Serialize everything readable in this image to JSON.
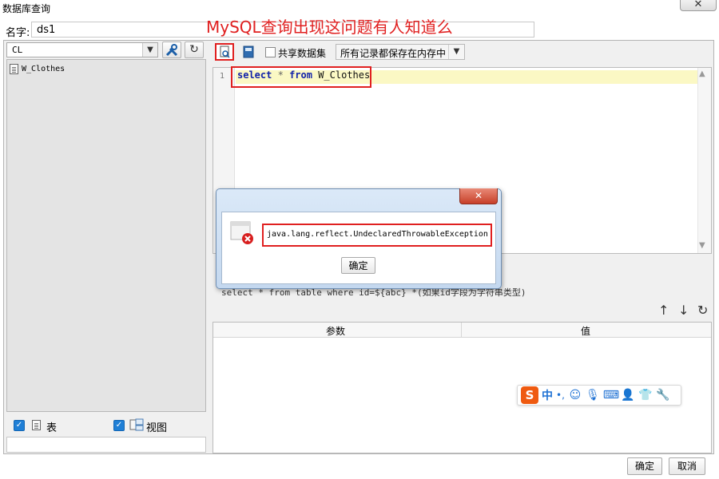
{
  "window": {
    "title": "数据库查询",
    "close_glyph": "✕"
  },
  "name_field": {
    "label": "名字:",
    "value": "ds1"
  },
  "annotation": "MySQL查询出现这问题有人知道么",
  "left_panel": {
    "connection": "CL",
    "tree_items": [
      "W_Clothes"
    ],
    "filter_table_label": "表",
    "filter_view_label": "视图"
  },
  "toolbar": {
    "share_label": "共享数据集",
    "memory_option": "所有记录都保存在内存中"
  },
  "editor": {
    "line_number": "1",
    "sql": {
      "kw_select": "select",
      "star": "*",
      "kw_from": "from",
      "table": "W_Clothes"
    }
  },
  "hint": "select * from table where id=${abc} *(如果id字段为字符串类型)",
  "params": {
    "col_name": "参数",
    "col_value": "值"
  },
  "dialog": {
    "message": "java.lang.reflect.UndeclaredThrowableException",
    "ok_label": "确定"
  },
  "ime": {
    "logo": "S",
    "mode": "中",
    "punct": "•,",
    "icons": [
      "smile-icon",
      "mic-icon",
      "keyboard-icon",
      "user-icon",
      "shirt-icon",
      "wrench-icon"
    ]
  },
  "buttons": {
    "ok": "确定",
    "cancel": "取消"
  },
  "colors": {
    "annotation_red": "#e02020",
    "checkbox_blue": "#1f7fd6",
    "ime_orange": "#ef5a10"
  }
}
